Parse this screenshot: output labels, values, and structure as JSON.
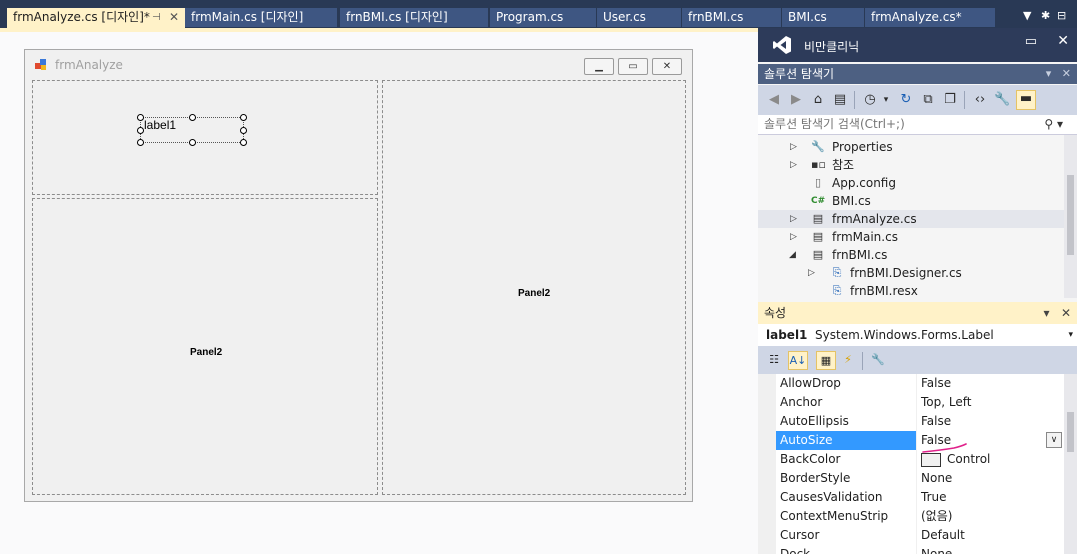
{
  "tabs": [
    {
      "label": "frmAnalyze.cs [디자인]*",
      "active": true
    },
    {
      "label": "frmMain.cs [디자인]"
    },
    {
      "label": "frnBMI.cs [디자인]"
    },
    {
      "label": "Program.cs"
    },
    {
      "label": "User.cs"
    },
    {
      "label": "frnBMI.cs"
    },
    {
      "label": "BMI.cs"
    },
    {
      "label": "frmAnalyze.cs*"
    }
  ],
  "form": {
    "title": "frmAnalyze",
    "label1": "label1",
    "panel_left_bottom": "Panel2",
    "panel_right": "Panel2"
  },
  "header": {
    "user_name": "비만클리닉"
  },
  "solution_explorer": {
    "title": "솔루션 탐색기",
    "search_placeholder": "솔루션 탐색기 검색(Ctrl+;)",
    "items": [
      {
        "label": "Properties",
        "icon": "wrench-icon"
      },
      {
        "label": "참조",
        "icon": "references-icon"
      },
      {
        "label": "App.config",
        "icon": "config-file-icon"
      },
      {
        "label": "BMI.cs",
        "icon": "csharp-file-icon"
      },
      {
        "label": "frmAnalyze.cs",
        "icon": "form-icon",
        "selected": true
      },
      {
        "label": "frmMain.cs",
        "icon": "form-icon"
      },
      {
        "label": "frnBMI.cs",
        "icon": "form-icon"
      },
      {
        "label": "frnBMI.Designer.cs",
        "icon": "designer-file-icon"
      },
      {
        "label": "frnBMI.resx",
        "icon": "resx-file-icon"
      }
    ]
  },
  "properties": {
    "title": "속성",
    "object_name": "label1",
    "object_type": "System.Windows.Forms.Label",
    "rows": [
      {
        "name": "AllowDrop",
        "value": "False"
      },
      {
        "name": "Anchor",
        "value": "Top, Left"
      },
      {
        "name": "AutoEllipsis",
        "value": "False"
      },
      {
        "name": "AutoSize",
        "value": "False",
        "selected": true
      },
      {
        "name": "BackColor",
        "value": "Control"
      },
      {
        "name": "BorderStyle",
        "value": "None"
      },
      {
        "name": "CausesValidation",
        "value": "True"
      },
      {
        "name": "ContextMenuStrip",
        "value": "(없음)"
      },
      {
        "name": "Cursor",
        "value": "Default"
      },
      {
        "name": "Dock",
        "value": "None"
      }
    ]
  },
  "colors": {
    "accent_yellow": "#fff2c8",
    "selection_blue": "#3399ff",
    "tab_bar": "#293955"
  }
}
